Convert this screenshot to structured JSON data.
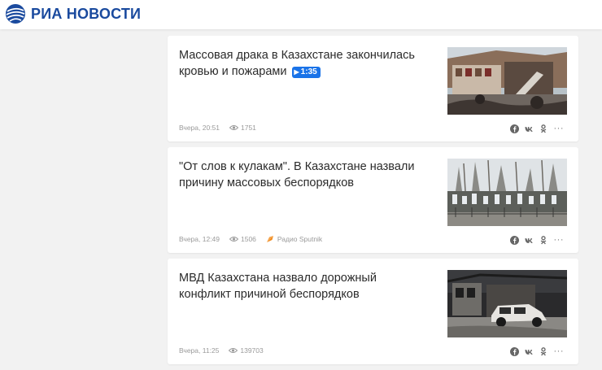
{
  "header": {
    "logo_text": "РИА НОВОСТИ",
    "logo_icon": "ria-globe-logo",
    "brand_color": "#1a4a9e"
  },
  "news": [
    {
      "title": "Массовая драка в Казахстане закончилась кровью и пожарами",
      "video_duration": "1:35",
      "time": "Вчера, 20:51",
      "views": "1751",
      "source": ""
    },
    {
      "title": "\"От слов к кулакам\". В Казахстане назвали причину массовых беспорядков",
      "video_duration": "",
      "time": "Вчера, 12:49",
      "views": "1506",
      "source": "Радио Sputnik"
    },
    {
      "title": "МВД Казахстана назвало дорожный конфликт причиной беспорядков",
      "video_duration": "",
      "time": "Вчера, 11:25",
      "views": "139703",
      "source": ""
    }
  ],
  "share_icons": [
    "facebook-icon",
    "vk-icon",
    "odnoklassniki-icon",
    "more-icon"
  ],
  "colors": {
    "page_bg": "#f2f2f2",
    "video_badge": "#1a73e8",
    "sputnik_orange": "#f08a1c"
  }
}
